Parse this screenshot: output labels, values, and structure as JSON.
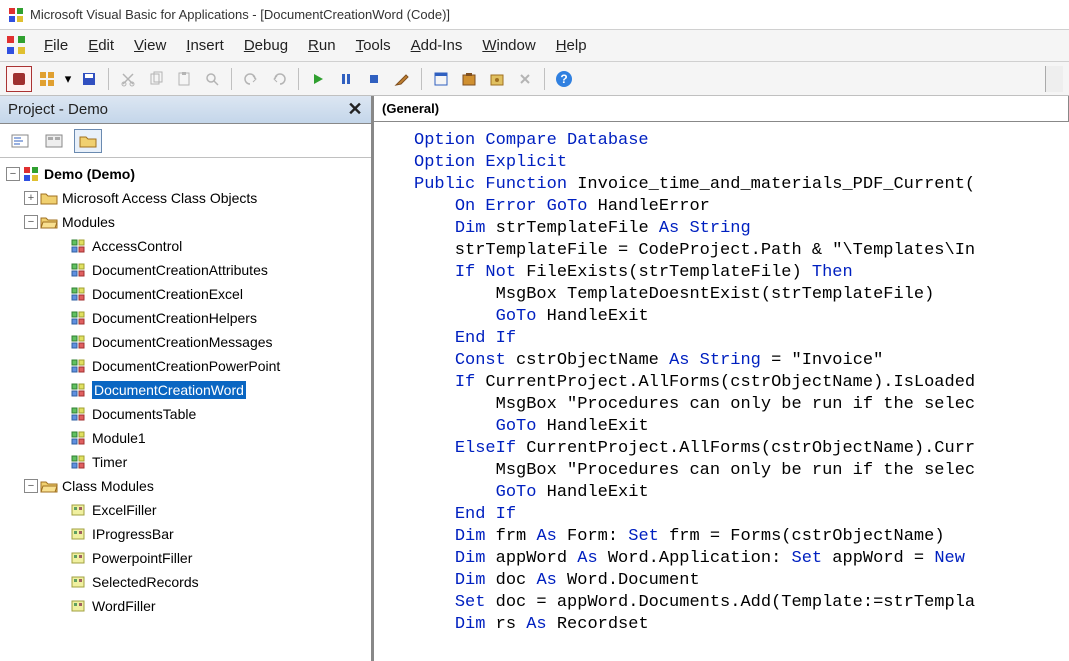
{
  "window": {
    "title": "Microsoft Visual Basic for Applications - [DocumentCreationWord (Code)]"
  },
  "menu": {
    "items": [
      "File",
      "Edit",
      "View",
      "Insert",
      "Debug",
      "Run",
      "Tools",
      "Add-Ins",
      "Window",
      "Help"
    ]
  },
  "project_pane": {
    "title": "Project - Demo",
    "root": "Demo (Demo)",
    "access_objects": "Microsoft Access Class Objects",
    "modules_folder": "Modules",
    "modules": [
      "AccessControl",
      "DocumentCreationAttributes",
      "DocumentCreationExcel",
      "DocumentCreationHelpers",
      "DocumentCreationMessages",
      "DocumentCreationPowerPoint",
      "DocumentCreationWord",
      "DocumentsTable",
      "Module1",
      "Timer"
    ],
    "class_modules_folder": "Class Modules",
    "class_modules": [
      "ExcelFiller",
      "IProgressBar",
      "PowerpointFiller",
      "SelectedRecords",
      "WordFiller"
    ],
    "selected": "DocumentCreationWord"
  },
  "code_header": {
    "general": "(General)"
  },
  "code": {
    "lines": [
      {
        "t": [
          [
            "kw",
            "Option Compare Database"
          ]
        ]
      },
      {
        "t": [
          [
            "kw",
            "Option Explicit"
          ]
        ]
      },
      {
        "t": [
          [
            "kw",
            "Public Function"
          ],
          [
            "plain",
            " Invoice_time_and_materials_PDF_Current("
          ]
        ]
      },
      {
        "t": [
          [
            "plain",
            "    "
          ],
          [
            "kw",
            "On Error GoTo"
          ],
          [
            "plain",
            " HandleError"
          ]
        ]
      },
      {
        "t": [
          [
            "plain",
            "    "
          ],
          [
            "kw",
            "Dim"
          ],
          [
            "plain",
            " strTemplateFile "
          ],
          [
            "kw",
            "As String"
          ]
        ]
      },
      {
        "t": [
          [
            "plain",
            "    strTemplateFile = CodeProject.Path & \"\\Templates\\In"
          ]
        ]
      },
      {
        "t": [
          [
            "plain",
            "    "
          ],
          [
            "kw",
            "If Not"
          ],
          [
            "plain",
            " FileExists(strTemplateFile) "
          ],
          [
            "kw",
            "Then"
          ]
        ]
      },
      {
        "t": [
          [
            "plain",
            "        MsgBox TemplateDoesntExist(strTemplateFile)"
          ]
        ]
      },
      {
        "t": [
          [
            "plain",
            "        "
          ],
          [
            "kw",
            "GoTo"
          ],
          [
            "plain",
            " HandleExit"
          ]
        ]
      },
      {
        "t": [
          [
            "plain",
            "    "
          ],
          [
            "kw",
            "End If"
          ]
        ]
      },
      {
        "t": [
          [
            "plain",
            "    "
          ],
          [
            "kw",
            "Const"
          ],
          [
            "plain",
            " cstrObjectName "
          ],
          [
            "kw",
            "As String"
          ],
          [
            "plain",
            " = \"Invoice\""
          ]
        ]
      },
      {
        "t": [
          [
            "plain",
            "    "
          ],
          [
            "kw",
            "If"
          ],
          [
            "plain",
            " CurrentProject.AllForms(cstrObjectName).IsLoaded"
          ]
        ]
      },
      {
        "t": [
          [
            "plain",
            "        MsgBox \"Procedures can only be run if the selec"
          ]
        ]
      },
      {
        "t": [
          [
            "plain",
            "        "
          ],
          [
            "kw",
            "GoTo"
          ],
          [
            "plain",
            " HandleExit"
          ]
        ]
      },
      {
        "t": [
          [
            "plain",
            "    "
          ],
          [
            "kw",
            "ElseIf"
          ],
          [
            "plain",
            " CurrentProject.AllForms(cstrObjectName).Curr"
          ]
        ]
      },
      {
        "t": [
          [
            "plain",
            "        MsgBox \"Procedures can only be run if the selec"
          ]
        ]
      },
      {
        "t": [
          [
            "plain",
            "        "
          ],
          [
            "kw",
            "GoTo"
          ],
          [
            "plain",
            " HandleExit"
          ]
        ]
      },
      {
        "t": [
          [
            "plain",
            "    "
          ],
          [
            "kw",
            "End If"
          ]
        ]
      },
      {
        "t": [
          [
            "plain",
            "    "
          ],
          [
            "kw",
            "Dim"
          ],
          [
            "plain",
            " frm "
          ],
          [
            "kw",
            "As"
          ],
          [
            "plain",
            " Form: "
          ],
          [
            "kw",
            "Set"
          ],
          [
            "plain",
            " frm = Forms(cstrObjectName)"
          ]
        ]
      },
      {
        "t": [
          [
            "plain",
            "    "
          ],
          [
            "kw",
            "Dim"
          ],
          [
            "plain",
            " appWord "
          ],
          [
            "kw",
            "As"
          ],
          [
            "plain",
            " Word.Application: "
          ],
          [
            "kw",
            "Set"
          ],
          [
            "plain",
            " appWord = "
          ],
          [
            "kw",
            "New"
          ],
          [
            "plain",
            " "
          ]
        ]
      },
      {
        "t": [
          [
            "plain",
            "    "
          ],
          [
            "kw",
            "Dim"
          ],
          [
            "plain",
            " doc "
          ],
          [
            "kw",
            "As"
          ],
          [
            "plain",
            " Word.Document"
          ]
        ]
      },
      {
        "t": [
          [
            "plain",
            "    "
          ],
          [
            "kw",
            "Set"
          ],
          [
            "plain",
            " doc = appWord.Documents.Add(Template:=strTempla"
          ]
        ]
      },
      {
        "t": [
          [
            "plain",
            "    "
          ],
          [
            "kw",
            "Dim"
          ],
          [
            "plain",
            " rs "
          ],
          [
            "kw",
            "As"
          ],
          [
            "plain",
            " Recordset"
          ]
        ]
      }
    ]
  }
}
